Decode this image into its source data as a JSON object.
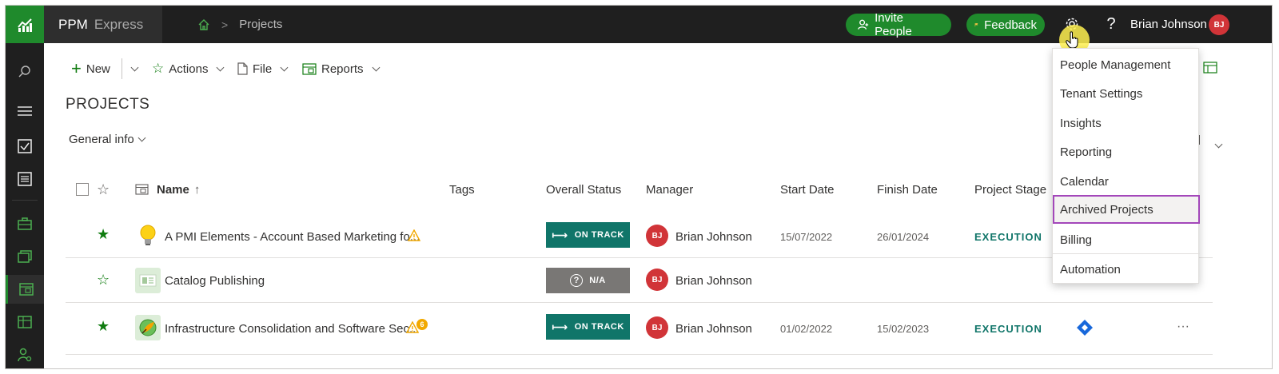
{
  "brand": {
    "name": "PPM",
    "suffix": "Express"
  },
  "breadcrumb": {
    "current": "Projects"
  },
  "header": {
    "invite_label": "Invite People",
    "feedback_label": "Feedback",
    "help_label": "?",
    "user_name": "Brian Johnson",
    "user_initials": "BJ"
  },
  "commands": {
    "new": "New",
    "actions": "Actions",
    "file": "File",
    "reports": "Reports"
  },
  "page_title": "PROJECTS",
  "view_selector": "General info",
  "columns": {
    "name": "Name",
    "name_sort": "↑",
    "tags": "Tags",
    "overall_status": "Overall Status",
    "manager": "Manager",
    "start_date": "Start Date",
    "finish_date": "Finish Date",
    "project_stage": "Project Stage"
  },
  "rows": [
    {
      "starred": true,
      "name": "A PMI Elements - Account Based Marketing fo...",
      "status": "ON TRACK",
      "manager": "Brian Johnson",
      "manager_initials": "BJ",
      "start": "15/07/2022",
      "finish": "26/01/2024",
      "stage": "EXECUTION"
    },
    {
      "starred": false,
      "name": "Catalog Publishing",
      "status": "N/A",
      "manager": "Brian Johnson",
      "manager_initials": "BJ",
      "start": "",
      "finish": "",
      "stage": "",
      "more": "···"
    },
    {
      "starred": true,
      "name": "Infrastructure Consolidation and Software Sec...",
      "warning_count": "6",
      "status": "ON TRACK",
      "manager": "Brian Johnson",
      "manager_initials": "BJ",
      "start": "01/02/2022",
      "finish": "15/02/2023",
      "stage": "EXECUTION",
      "more": "···"
    }
  ],
  "settings_menu": {
    "items": [
      "People Management",
      "Tenant Settings",
      "Insights",
      "Reporting",
      "Calendar",
      "Archived Projects",
      "Billing",
      "Automation"
    ],
    "highlighted": "Archived Projects"
  },
  "colors": {
    "brand_green": "#1f8a2c",
    "status_teal": "#107569",
    "avatar_red": "#d13438",
    "highlight_border": "#a347ba"
  }
}
